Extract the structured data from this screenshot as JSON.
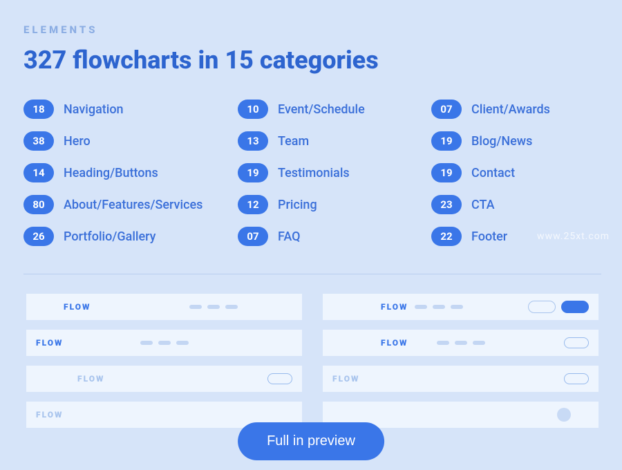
{
  "eyebrow": "ELEMENTS",
  "title": "327 flowcharts in 15 categories",
  "categories": [
    {
      "count": "18",
      "label": "Navigation"
    },
    {
      "count": "10",
      "label": "Event/Schedule"
    },
    {
      "count": "07",
      "label": "Client/Awards"
    },
    {
      "count": "38",
      "label": "Hero"
    },
    {
      "count": "13",
      "label": "Team"
    },
    {
      "count": "19",
      "label": "Blog/News"
    },
    {
      "count": "14",
      "label": "Heading/Buttons"
    },
    {
      "count": "19",
      "label": "Testimonials"
    },
    {
      "count": "19",
      "label": "Contact"
    },
    {
      "count": "80",
      "label": "About/Features/Services"
    },
    {
      "count": "12",
      "label": "Pricing"
    },
    {
      "count": "23",
      "label": "CTA"
    },
    {
      "count": "26",
      "label": "Portfolio/Gallery"
    },
    {
      "count": "07",
      "label": "FAQ"
    },
    {
      "count": "22",
      "label": "Footer"
    }
  ],
  "flow_label": "FLOW",
  "cta_label": "Full in preview",
  "watermark": "www.25xt.com"
}
